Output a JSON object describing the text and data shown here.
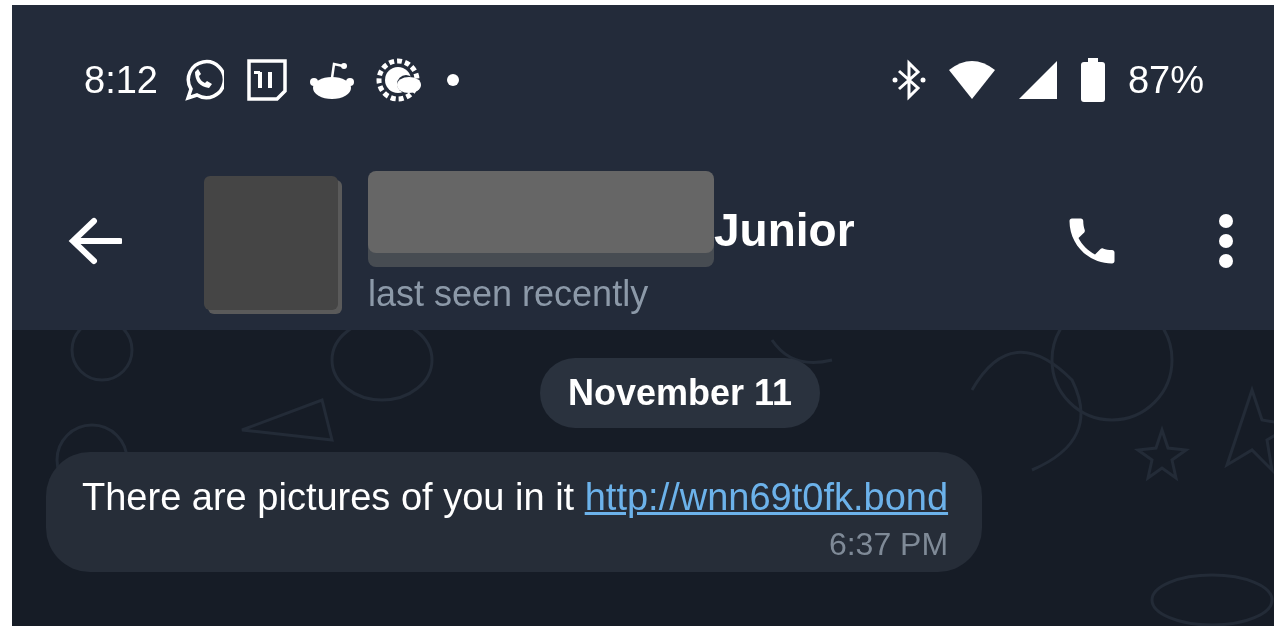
{
  "status_bar": {
    "time": "8:12",
    "battery": "87%"
  },
  "header": {
    "name_visible": "Junior",
    "status": "last seen recently"
  },
  "chat": {
    "date": "November 11",
    "messages": [
      {
        "text": "There are pictures of you in it",
        "link": "http://wnn69t0fk.bond",
        "time": "6:37 PM"
      }
    ]
  }
}
